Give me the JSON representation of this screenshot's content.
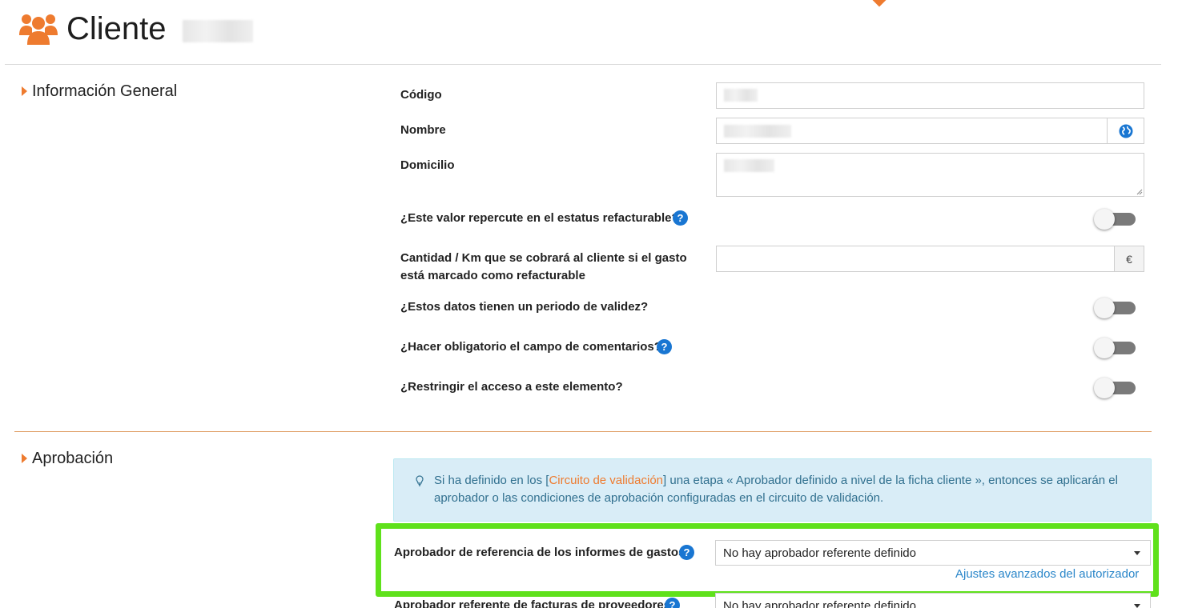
{
  "header": {
    "title": "Cliente",
    "title_icon": "users-icon"
  },
  "general": {
    "heading": "Información General",
    "codigo_label": "Código",
    "nombre_label": "Nombre",
    "nombre_icon": "globe-icon",
    "domicilio_label": "Domicilio",
    "refacturable_label": "¿Este valor repercute en el estatus refacturable?",
    "cantidad_label_line1": "Cantidad / Km que se cobrará al cliente si el gasto",
    "cantidad_label_line2": "está marcado como refacturable",
    "currency_symbol": "€",
    "validez_label": "¿Estos datos tienen un periodo de validez?",
    "comentarios_label": "¿Hacer obligatorio el campo de comentarios?",
    "restringir_label": "¿Restringir el acceso a este elemento?",
    "help_glyph": "?"
  },
  "aprobacion": {
    "heading": "Aprobación",
    "info_prefix": "Si ha definido en los [",
    "info_link": "Circuito de validación",
    "info_suffix": "] una etapa « Aprobador definido a nivel de la ficha cliente », entonces se aplicarán el aprobador o las condiciones de aprobación configuradas en el circuito de validación.",
    "informes_label": "Aprobador de referencia de los informes de gastos",
    "informes_value": "No hay aprobador referente definido",
    "advanced_link": "Ajustes avanzados del autorizador",
    "facturas_label": "Aprobador referente de facturas de proveedores",
    "facturas_value": "No hay aprobador referente definido"
  },
  "colors": {
    "accent": "#ee7b2f",
    "highlight": "#5fe11b",
    "help": "#1976d2",
    "info_bg": "#d9edf7",
    "link": "#2a86c9"
  }
}
